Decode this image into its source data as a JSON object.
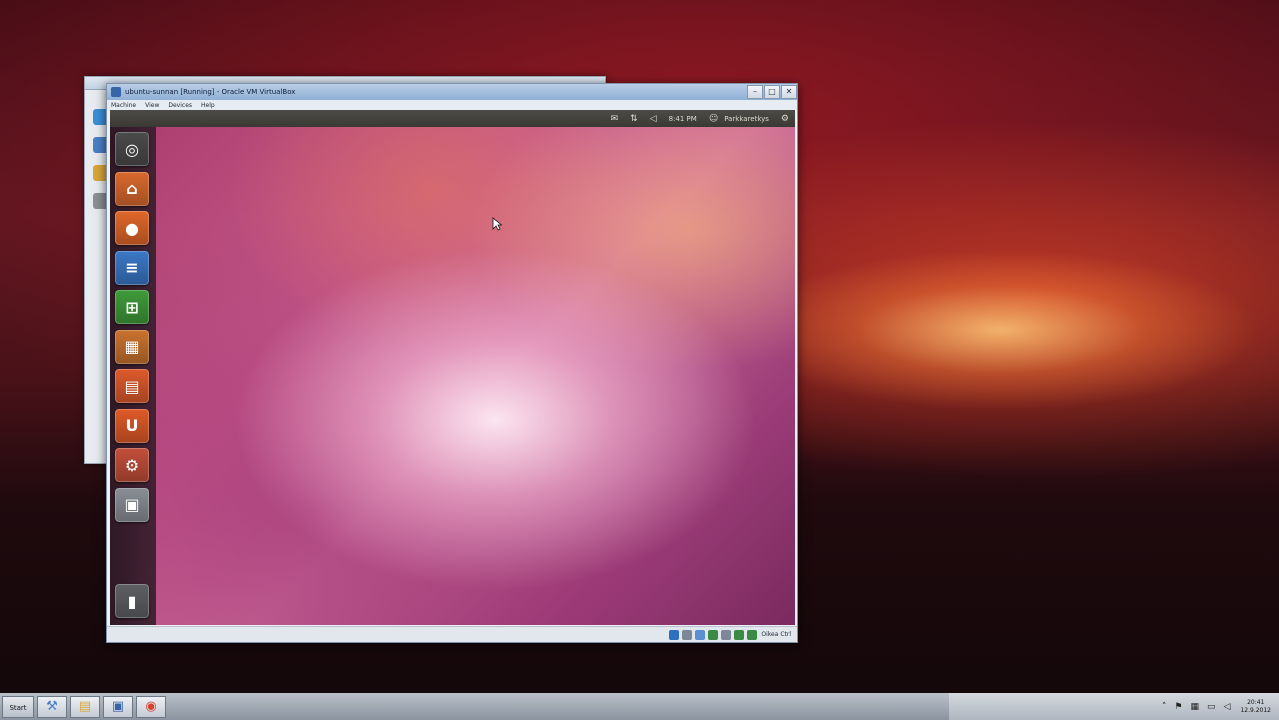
{
  "host": {
    "back_window": {
      "side_icons": [
        {
          "icon": "ie-icon",
          "color": "#3a8fd8"
        },
        {
          "icon": "document-icon",
          "color": "#4a7fc6"
        },
        {
          "icon": "folder-icon",
          "color": "#d8a63a"
        },
        {
          "icon": "settings-icon",
          "color": "#8b8f96"
        }
      ]
    },
    "taskbar": {
      "start_label": "Start",
      "tiles": [
        {
          "name": "taskbar-explorer",
          "icon": "explorer-icon",
          "glyph": "⚒",
          "color": "#4a7fc6"
        },
        {
          "name": "taskbar-folder",
          "icon": "folder-icon",
          "glyph": "▤",
          "color": "#d8a63a"
        },
        {
          "name": "taskbar-virtualbox",
          "icon": "virtualbox-icon",
          "glyph": "▣",
          "color": "#3a64a8"
        },
        {
          "name": "taskbar-chrome",
          "icon": "chrome-icon",
          "glyph": "◉",
          "color": "#d8432f"
        }
      ],
      "tray_icons": [
        {
          "icon": "chevron-up-icon",
          "glyph": "˄"
        },
        {
          "icon": "flag-icon",
          "glyph": "⚑"
        },
        {
          "icon": "network-icon",
          "glyph": "▦"
        },
        {
          "icon": "monitor-icon",
          "glyph": "▭"
        },
        {
          "icon": "speaker-icon",
          "glyph": "◁"
        }
      ],
      "clock_time": "20:41",
      "clock_date": "12.9.2012"
    }
  },
  "vbox": {
    "title": "ubuntu-sunnan [Running] - Oracle VM VirtualBox",
    "menu": [
      "Machine",
      "View",
      "Devices",
      "Help"
    ],
    "controls": [
      "–",
      "□",
      "✕"
    ],
    "statusbar": {
      "icons": [
        {
          "icon": "cd-icon",
          "color": "#2f6fbf"
        },
        {
          "icon": "usb-icon",
          "color": "#7c8797"
        },
        {
          "icon": "shared-folder-icon",
          "color": "#5a8fd0"
        },
        {
          "icon": "network-icon",
          "color": "#3b8a46"
        },
        {
          "icon": "video-capture-icon",
          "color": "#7c8797"
        },
        {
          "icon": "mouse-integration-icon",
          "color": "#3b8a46"
        },
        {
          "icon": "keyboard-icon",
          "color": "#3b8a46"
        }
      ],
      "host_key": "Oikea Ctrl"
    }
  },
  "guest": {
    "panel": {
      "icons": [
        {
          "icon": "mail-icon",
          "glyph": "✉"
        },
        {
          "icon": "network-arrows-icon",
          "glyph": "⇅"
        },
        {
          "icon": "speaker-icon",
          "glyph": "◁"
        }
      ],
      "time": "8:41 PM",
      "user_glyph": "☺",
      "user": "Parkkaretkys",
      "power_glyph": "⚙"
    },
    "launcher": [
      {
        "name": "launcher-dash",
        "icon": "dash-icon",
        "color": "#4b4b4b",
        "glyph": "◎"
      },
      {
        "name": "launcher-home-folder",
        "icon": "home-folder-icon",
        "color": "#d9692e",
        "glyph": "⌂"
      },
      {
        "name": "launcher-firefox",
        "icon": "firefox-icon",
        "color": "#e0672a",
        "glyph": "●"
      },
      {
        "name": "launcher-writer",
        "icon": "writer-icon",
        "color": "#3b78c6",
        "glyph": "≡"
      },
      {
        "name": "launcher-calc",
        "icon": "calc-icon",
        "color": "#3f9b3a",
        "glyph": "⊞"
      },
      {
        "name": "launcher-impress",
        "icon": "impress-icon",
        "color": "#c9732f",
        "glyph": "▦"
      },
      {
        "name": "launcher-software-center",
        "icon": "software-center-icon",
        "color": "#dd5a2c",
        "glyph": "▤"
      },
      {
        "name": "launcher-ubuntu-one",
        "icon": "ubuntu-one-icon",
        "color": "#df5a28",
        "glyph": "U"
      },
      {
        "name": "launcher-system-settings",
        "icon": "system-settings-icon",
        "color": "#c24f3a",
        "glyph": "⚙"
      },
      {
        "name": "launcher-workspaces",
        "icon": "workspaces-icon",
        "color": "#8a8f96",
        "glyph": "▣"
      },
      {
        "name": "launcher-trash",
        "icon": "trash-icon",
        "color": "#5e6064",
        "glyph": "▮"
      }
    ]
  }
}
